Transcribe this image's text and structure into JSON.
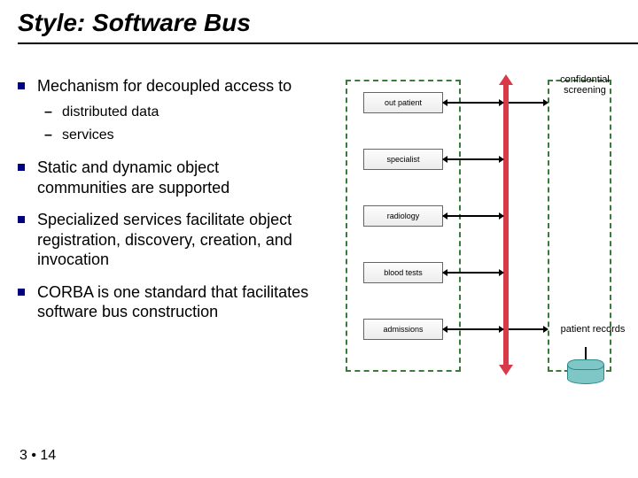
{
  "title": "Style: Software Bus",
  "bullets": [
    {
      "text": "Mechanism for decoupled access to",
      "subs": [
        "distributed data",
        "services"
      ]
    },
    {
      "text": "Static and dynamic object communities are supported"
    },
    {
      "text": "Specialized services facilitate object registration, discovery, creation, and invocation"
    },
    {
      "text": "CORBA is one standard that facilitates software bus construction"
    }
  ],
  "diagram": {
    "nodes": [
      "out patient",
      "specialist",
      "radiology",
      "blood tests",
      "admissions"
    ],
    "right_top_label": "confidential screening",
    "right_bottom_label": "patient records"
  },
  "page_number": "3 • 14"
}
